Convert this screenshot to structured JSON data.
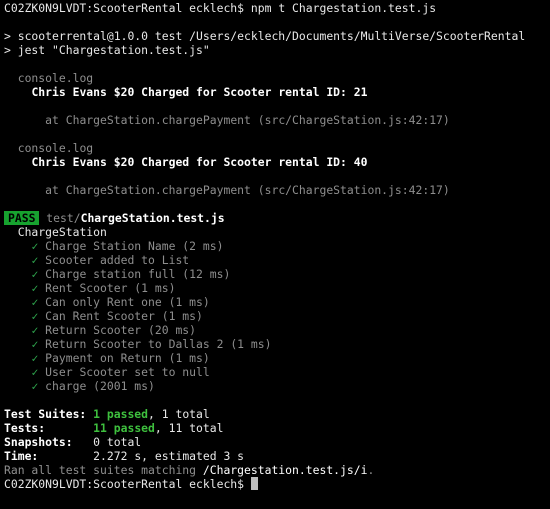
{
  "prompt1": {
    "host": "C02ZK0N9LVDT:ScooterRental ecklech$",
    "command": "npm t Chargestation.test.js"
  },
  "npm_out": {
    "line1": "> scooterrental@1.0.0 test /Users/ecklech/Documents/MultiVerse/ScooterRental",
    "line2": "> jest \"Chargestation.test.js\""
  },
  "logs": [
    {
      "label": "console.log",
      "message": "Chris Evans $20 Charged for Scooter rental ID: 21",
      "location": "at ChargeStation.chargePayment (src/ChargeStation.js:42:17)"
    },
    {
      "label": "console.log",
      "message": "Chris Evans $20 Charged for Scooter rental ID: 40",
      "location": "at ChargeStation.chargePayment (src/ChargeStation.js:42:17)"
    }
  ],
  "result": {
    "badge": "PASS",
    "dir": "test/",
    "file": "ChargeStation.test.js"
  },
  "suite": {
    "name": "ChargeStation",
    "check_glyph": "✓",
    "tests": [
      "Charge Station Name (2 ms)",
      "Scooter added to List",
      "Charge station full (12 ms)",
      "Rent Scooter (1 ms)",
      "Can only Rent one (1 ms)",
      "Can Rent Scooter (1 ms)",
      "Return Scooter (20 ms)",
      "Return Scooter to Dallas 2 (1 ms)",
      "Payment on Return (1 ms)",
      "User Scooter set to null",
      "charge (2001 ms)"
    ]
  },
  "summary": {
    "suites_label": "Test Suites:",
    "suites_passed": "1 passed",
    "suites_total": ", 1 total",
    "tests_label": "Tests:",
    "tests_passed": "11 passed",
    "tests_total": ", 11 total",
    "snapshots_label": "Snapshots:",
    "snapshots_value": "0 total",
    "time_label": "Time:",
    "time_value": "2.272 s, estimated 3 s",
    "ran_prefix": "Ran all test suites matching ",
    "ran_pattern": "/Chargestation.test.js/i",
    "ran_suffix": "."
  },
  "prompt2": {
    "host": "C02ZK0N9LVDT:ScooterRental ecklech$"
  },
  "colors": {
    "background": "#000000",
    "pass_badge": "#17a22f",
    "passed_text": "#3ec03e",
    "dim_text": "#8e8e8e"
  }
}
